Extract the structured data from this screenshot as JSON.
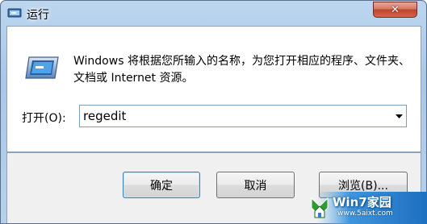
{
  "window": {
    "title": "运行",
    "close_glyph": "✕"
  },
  "icons": {
    "title": "run-icon",
    "main": "run-dialog-icon",
    "dropdown": "chevron-down-icon",
    "watermark": "windows-logo-icon"
  },
  "dialog": {
    "description": "Windows 将根据您所输入的名称，为您打开相应的程序、文件夹、文档或 Internet 资源。",
    "open_label": "打开(O):",
    "open_value": "regedit"
  },
  "buttons": {
    "ok": "确定",
    "cancel": "取消",
    "browse": "浏览(B)..."
  },
  "watermark": {
    "brand": "Win7家园",
    "url": "www.5aixt.com"
  },
  "colors": {
    "accent": "#3c7fb1",
    "close": "#c0432d"
  }
}
